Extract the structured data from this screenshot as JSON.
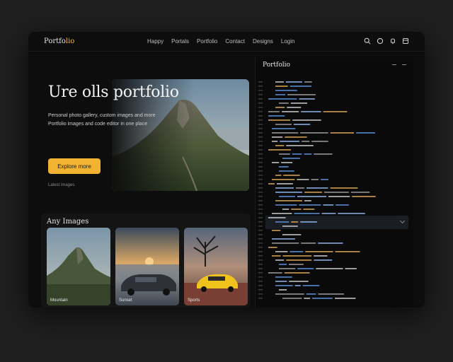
{
  "brand": {
    "prefix": "Portfo",
    "accent": "lio"
  },
  "nav": [
    "Happy",
    "Portals",
    "Portfolio",
    "Contact",
    "Designs",
    "Login"
  ],
  "toolbar_icons": [
    "search-icon",
    "circle-icon",
    "bell-icon",
    "window-icon"
  ],
  "hero": {
    "title": "Ure olls portfolio",
    "subtitle_line1": "Personal photo gallery, custom images and more",
    "subtitle_line2": "Portfolio images and code editor in one place",
    "cta_label": "Explore more",
    "note": "Latest images"
  },
  "gallery": {
    "title": "Any Images",
    "cards": [
      {
        "label": "Mountain"
      },
      {
        "label": "Sunset"
      },
      {
        "label": "Sports"
      }
    ]
  },
  "editor": {
    "title": "Portfolio"
  },
  "colors": {
    "accent": "#f2b232",
    "window_bg": "#0d0d0d",
    "code_blue": "#5b8fd8"
  }
}
